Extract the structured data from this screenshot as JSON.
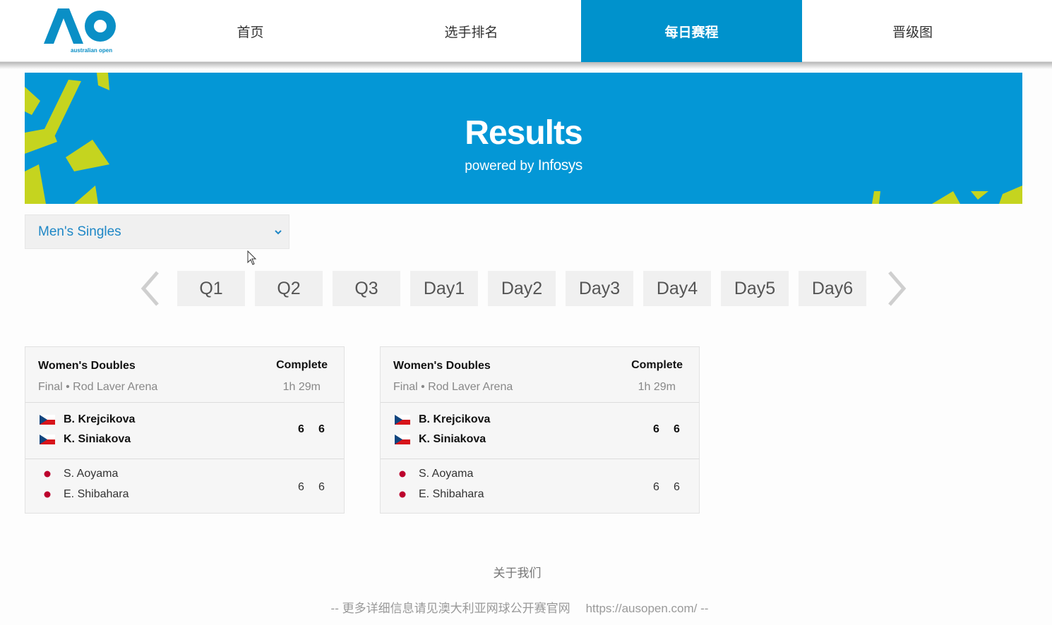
{
  "nav": {
    "logo_text": "australian open",
    "items": [
      {
        "label": "首页",
        "active": false
      },
      {
        "label": "选手排名",
        "active": false
      },
      {
        "label": "每日赛程",
        "active": true
      },
      {
        "label": "晋级图",
        "active": false
      }
    ]
  },
  "hero": {
    "title": "Results",
    "powered_by": "powered by",
    "brand": "Infosys"
  },
  "filter": {
    "selected": "Men's Singles"
  },
  "days": {
    "tabs": [
      "Q1",
      "Q2",
      "Q3",
      "Day1",
      "Day2",
      "Day3",
      "Day4",
      "Day5",
      "Day6"
    ]
  },
  "matches": [
    {
      "event": "Women's Doubles",
      "status": "Complete",
      "round": "Final • Rod Laver Arena",
      "duration": "1h 29m",
      "winner": {
        "players": [
          "B. Krejcikova",
          "K. Siniakova"
        ],
        "flag": "czech-flag-icon",
        "scores": [
          "6",
          "6"
        ]
      },
      "loser": {
        "players": [
          "S. Aoyama",
          "E. Shibahara"
        ],
        "flag": "japan-flag-icon",
        "scores": [
          "6",
          "6"
        ]
      }
    },
    {
      "event": "Women's Doubles",
      "status": "Complete",
      "round": "Final • Rod Laver Arena",
      "duration": "1h 29m",
      "winner": {
        "players": [
          "B. Krejcikova",
          "K. Siniakova"
        ],
        "flag": "czech-flag-icon",
        "scores": [
          "6",
          "6"
        ]
      },
      "loser": {
        "players": [
          "S. Aoyama",
          "E. Shibahara"
        ],
        "flag": "japan-flag-icon",
        "scores": [
          "6",
          "6"
        ]
      }
    }
  ],
  "footer": {
    "about": "关于我们",
    "note": "-- 更多详细信息请见澳大利亚网球公开赛官网",
    "url": "https://ausopen.com/ --"
  },
  "colors": {
    "brand_blue": "#0092cc",
    "hero_blue": "#0497d6",
    "accent_lime": "#c5d41f",
    "link_blue": "#1e87c6"
  }
}
